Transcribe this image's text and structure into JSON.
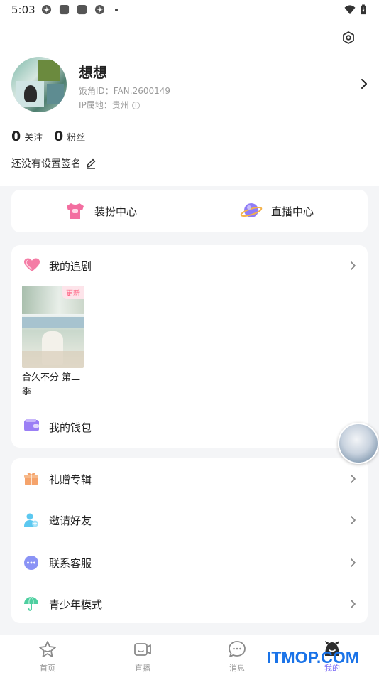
{
  "status_bar": {
    "time": "5:03"
  },
  "profile": {
    "nickname": "想想",
    "fan_id": "饭角ID：FAN.2600149",
    "ip_location": "IP属地：贵州"
  },
  "stats": {
    "following_count": "0",
    "following_label": "关注",
    "fans_count": "0",
    "fans_label": "粉丝"
  },
  "signature": "还没有设置签名",
  "centers": [
    {
      "label": "装扮中心",
      "icon": "t-shirt-icon"
    },
    {
      "label": "直播中心",
      "icon": "planet-icon"
    }
  ],
  "drama_section": {
    "title": "我的追剧",
    "items": [
      {
        "title": "合久不分 第二季",
        "badge": "更新"
      }
    ]
  },
  "wallet": {
    "label": "我的钱包"
  },
  "list_items": [
    {
      "label": "礼赠专辑",
      "icon": "gift-icon",
      "color": "#f5a36b"
    },
    {
      "label": "邀请好友",
      "icon": "invite-user-icon",
      "color": "#5cc8f0"
    },
    {
      "label": "联系客服",
      "icon": "chat-dots-icon",
      "color": "#8a93f5"
    },
    {
      "label": "青少年模式",
      "icon": "umbrella-icon",
      "color": "#4ecfa0"
    }
  ],
  "tabs": [
    {
      "label": "首页",
      "icon": "home-icon"
    },
    {
      "label": "直播",
      "icon": "video-icon"
    },
    {
      "label": "消息",
      "icon": "message-icon"
    },
    {
      "label": "我的",
      "icon": "profile-icon",
      "active": true
    }
  ],
  "watermark": "ITMOP.COM",
  "colors": {
    "accent": "#7b6cf6",
    "background": "#f4f5f7",
    "update_badge": "#ff5c7c"
  }
}
